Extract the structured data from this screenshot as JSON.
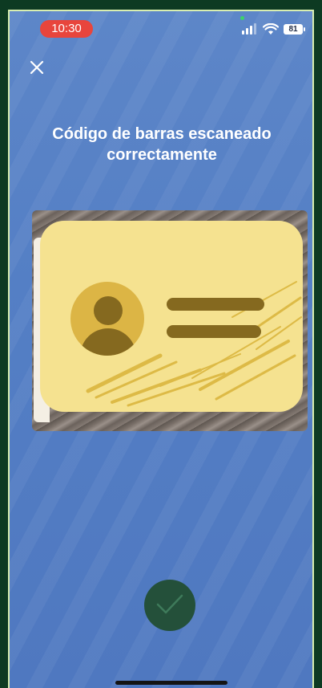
{
  "status_bar": {
    "time": "10:30",
    "battery": "81"
  },
  "header": {
    "close_icon": "close-icon"
  },
  "main": {
    "title": "Código de barras escaneado correctamente",
    "scanned_image": "id-card-illustration"
  },
  "footer": {
    "confirm_icon": "checkmark-icon"
  },
  "colors": {
    "background": "#5a84c7",
    "time_pill": "#e8453c",
    "card": "#f5e290",
    "card_accent": "#85691f",
    "confirm_button": "#24503a"
  }
}
